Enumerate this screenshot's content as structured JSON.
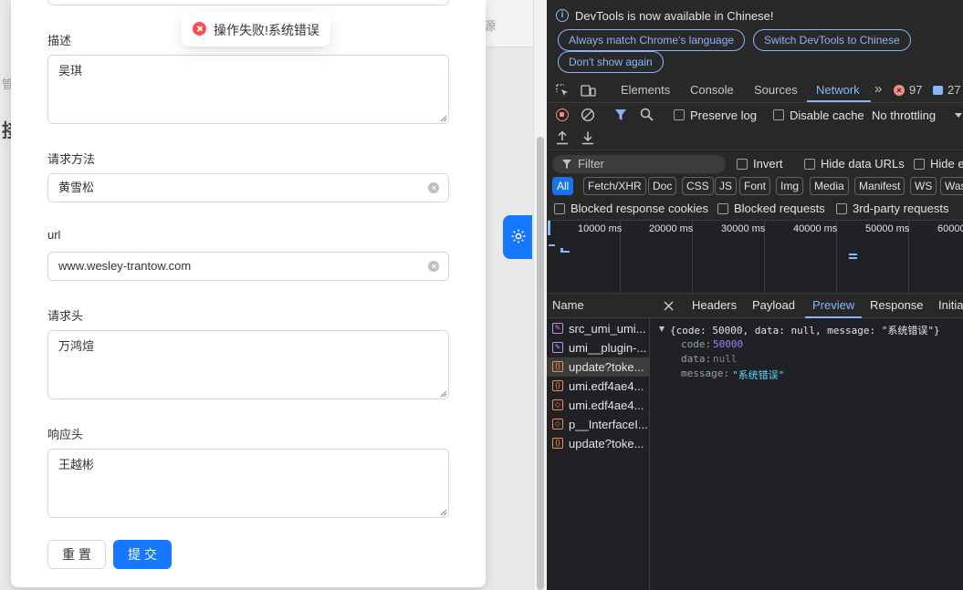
{
  "app": {
    "bg_header_text": "源",
    "bg_left_text1": "管",
    "bg_left_text2": "接"
  },
  "form": {
    "fields": [
      {
        "label": "描述",
        "value": "吴琪"
      },
      {
        "label": "请求方法",
        "value": "黄雪松"
      },
      {
        "label": "url",
        "value": "www.wesley-trantow.com"
      },
      {
        "label": "请求头",
        "value": "万鸿煊"
      },
      {
        "label": "响应头",
        "value": "王越彬"
      }
    ],
    "reset_label": "重 置",
    "submit_label": "提 交"
  },
  "toast": {
    "text": "操作失败!系统错误",
    "type": "error"
  },
  "devtools": {
    "infobar": {
      "message": "DevTools is now available in Chinese!",
      "buttons": [
        "Always match Chrome's language",
        "Switch DevTools to Chinese",
        "Don't show again"
      ]
    },
    "tabs": [
      "Elements",
      "Console",
      "Sources",
      "Network"
    ],
    "more_tabs": "»",
    "error_count": "97",
    "message_count": "27",
    "toolbar": {
      "preserve_log": "Preserve log",
      "disable_cache": "Disable cache",
      "throttling": "No throttling"
    },
    "filter": {
      "placeholder": "Filter",
      "invert": "Invert",
      "hide_data_urls": "Hide data URLs",
      "hide_extension": "Hide e",
      "types": [
        "All",
        "Fetch/XHR",
        "Doc",
        "CSS",
        "JS",
        "Font",
        "Img",
        "Media",
        "Manifest",
        "WS",
        "Was"
      ],
      "blocked_response_cookies": "Blocked response cookies",
      "blocked_requests": "Blocked requests",
      "third_party": "3rd-party requests"
    },
    "timeline_ticks": [
      "10000 ms",
      "20000 ms",
      "30000 ms",
      "40000 ms",
      "50000 ms",
      "60000"
    ],
    "name_header": "Name",
    "requests": [
      {
        "name": "src_umi_umi...",
        "kind": "doc"
      },
      {
        "name": "umi__plugin-...",
        "kind": "doc"
      },
      {
        "name": "update?toke...",
        "kind": "xhr",
        "selected": true
      },
      {
        "name": "umi.edf4ae4...",
        "kind": "xhr"
      },
      {
        "name": "umi.edf4ae4...",
        "kind": "xhr"
      },
      {
        "name": "p__InterfaceI...",
        "kind": "xhr"
      },
      {
        "name": "update?toke...",
        "kind": "xhr"
      }
    ],
    "detail_tabs": [
      "Headers",
      "Payload",
      "Preview",
      "Response",
      "Initia"
    ],
    "preview": {
      "summary": "{code: 50000, data: null, message: \"系统错误\"}",
      "code_key": "code:",
      "code_val": "50000",
      "data_key": "data:",
      "data_val": "null",
      "message_key": "message:",
      "message_val": "\"系统错误\""
    }
  }
}
